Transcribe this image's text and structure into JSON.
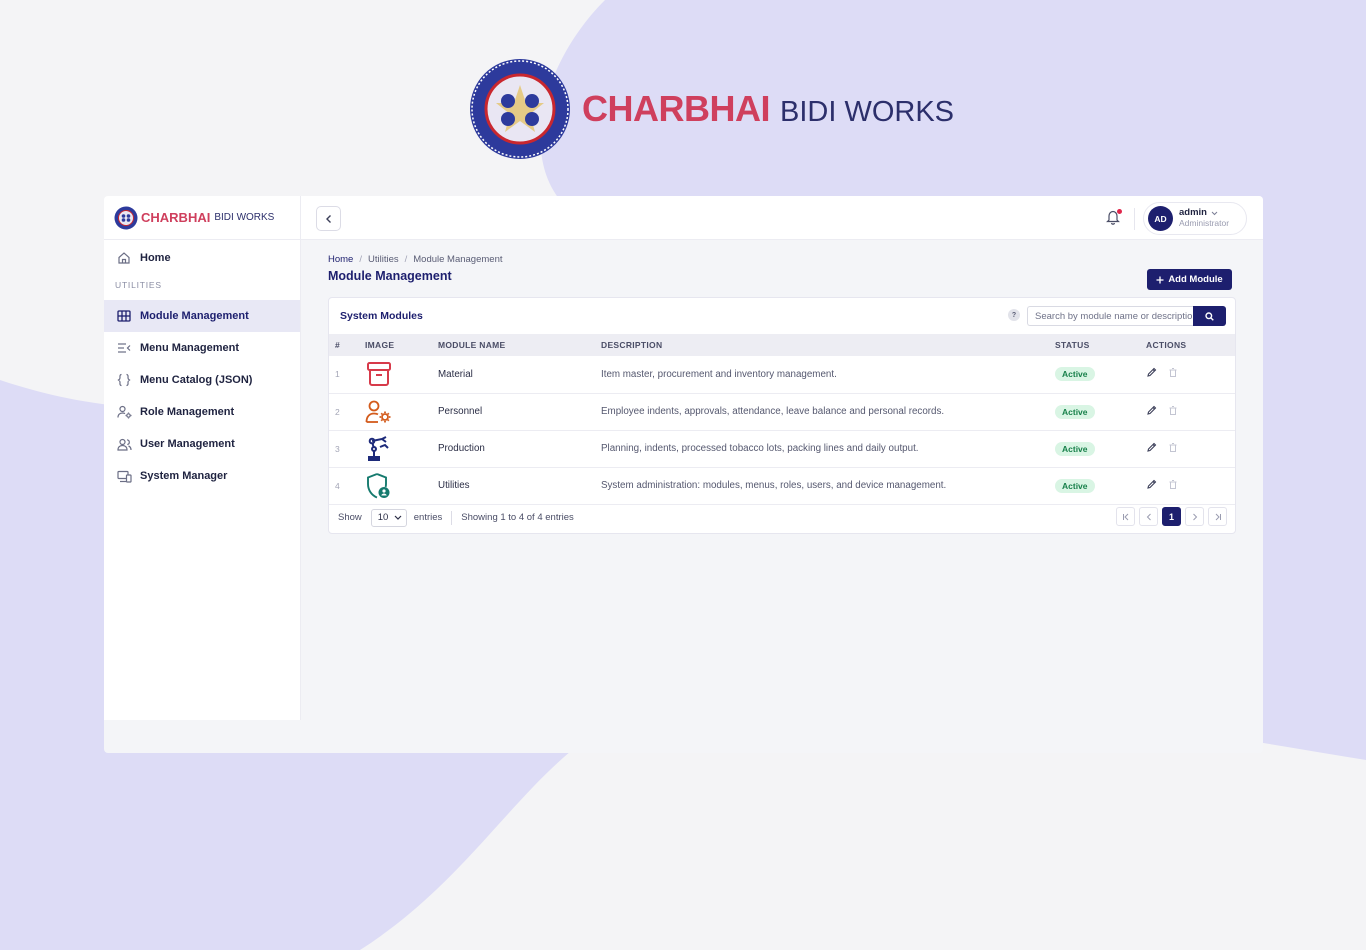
{
  "brand": {
    "name_bold": "CHARBHAI",
    "name_light": "BIDI WORKS"
  },
  "sidebar": {
    "home": "Home",
    "section": "UTILITIES",
    "items": [
      {
        "label": "Module Management",
        "icon": "grid-icon",
        "active": true
      },
      {
        "label": "Menu Management",
        "icon": "menu-list-icon",
        "active": false
      },
      {
        "label": "Menu Catalog (JSON)",
        "icon": "braces-icon",
        "active": false
      },
      {
        "label": "Role Management",
        "icon": "user-gear-icon",
        "active": false
      },
      {
        "label": "User Management",
        "icon": "users-icon",
        "active": false
      },
      {
        "label": "System Manager",
        "icon": "devices-icon",
        "active": false
      }
    ]
  },
  "topbar": {
    "user_initials": "AD",
    "user_name": "admin",
    "user_role": "Administrator"
  },
  "breadcrumb": {
    "home": "Home",
    "parent": "Utilities",
    "current": "Module Management"
  },
  "page_title": "Module Management",
  "add_button": "Add Module",
  "card": {
    "title": "System Modules",
    "help": "?",
    "search_placeholder": "Search by module name or description"
  },
  "table": {
    "headers": {
      "num": "#",
      "image": "IMAGE",
      "name": "MODULE NAME",
      "desc": "DESCRIPTION",
      "status": "STATUS",
      "actions": "ACTIONS"
    },
    "rows": [
      {
        "num": "1",
        "name": "Material",
        "desc": "Item master, procurement and inventory management.",
        "status": "Active",
        "icon": "archive-box-icon"
      },
      {
        "num": "2",
        "name": "Personnel",
        "desc": "Employee indents, approvals, attendance, leave balance and personal records.",
        "status": "Active",
        "icon": "user-gear-icon"
      },
      {
        "num": "3",
        "name": "Production",
        "desc": "Planning, indents, processed tobacco lots, packing lines and daily output.",
        "status": "Active",
        "icon": "robot-arm-icon"
      },
      {
        "num": "4",
        "name": "Utilities",
        "desc": "System administration: modules, menus, roles, users, and device management.",
        "status": "Active",
        "icon": "shield-user-icon"
      }
    ]
  },
  "footer": {
    "show": "Show",
    "page_size": "10",
    "entries": "entries",
    "summary": "Showing 1 to 4 of 4 entries",
    "current_page": "1"
  },
  "colors": {
    "primary": "#1d1f6e",
    "brand_red": "#cf3f5d",
    "active_bg": "#d9f5e4",
    "active_text": "#17804a",
    "notify": "#e0264b"
  }
}
